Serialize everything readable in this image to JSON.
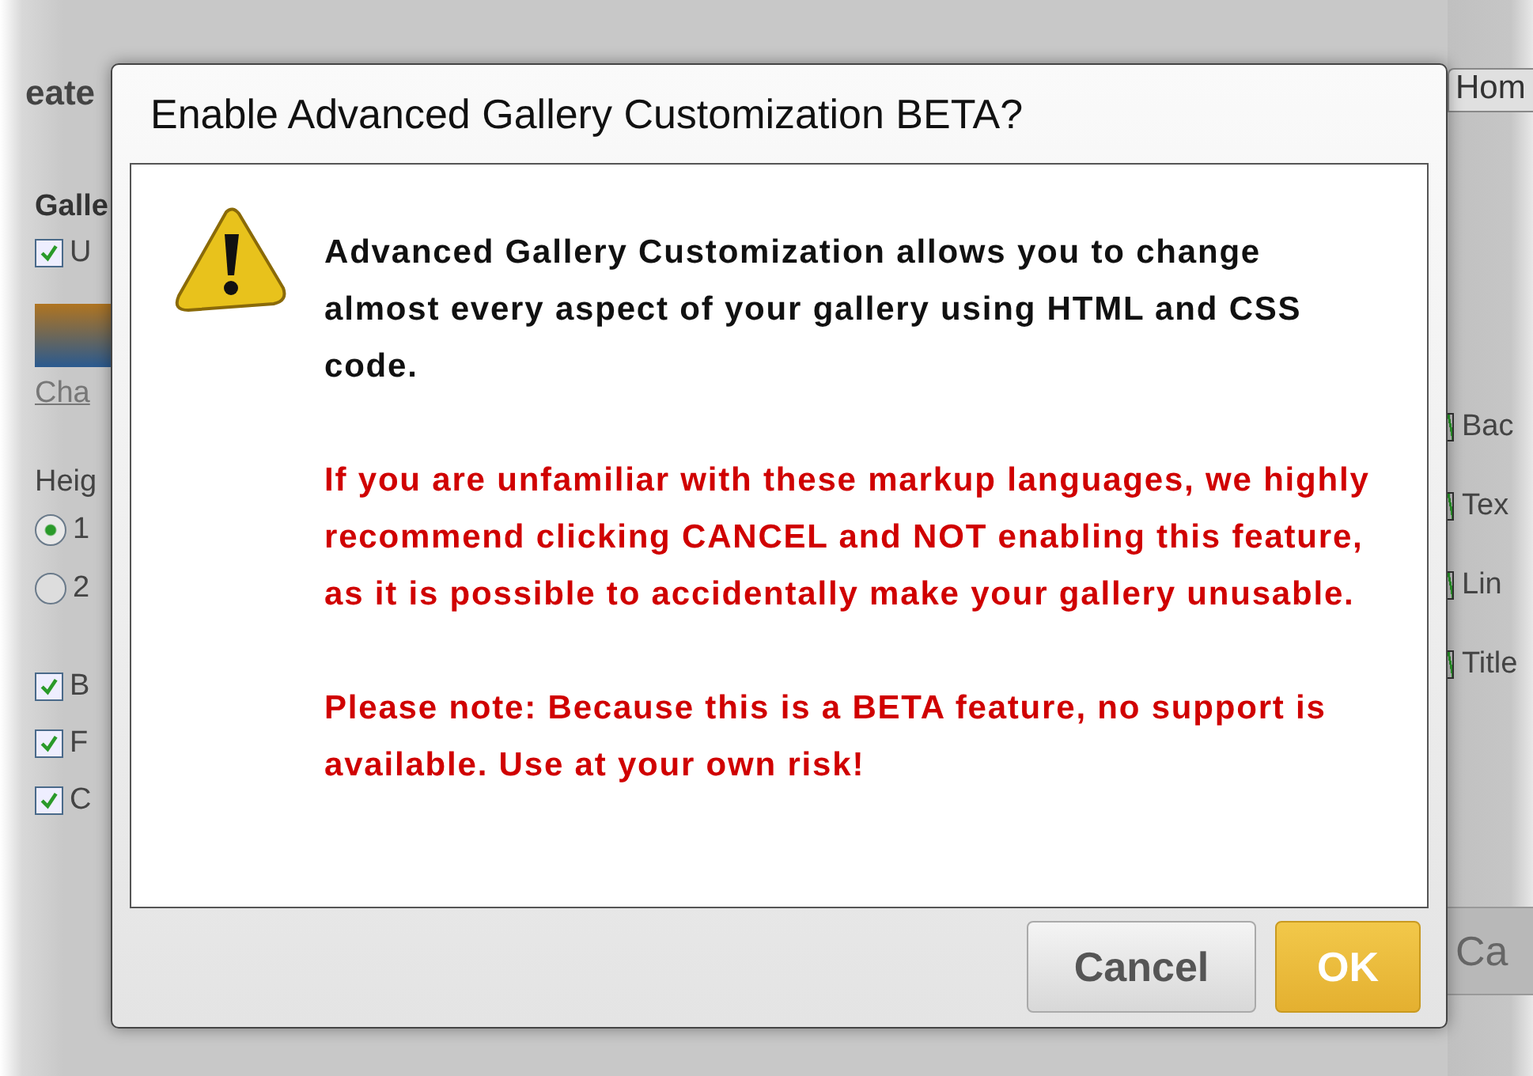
{
  "background": {
    "title_fragment": "eate",
    "section_heading": "Galle",
    "top_option": {
      "label": "U",
      "checked": true
    },
    "link": "Cha",
    "height_label": "Heig",
    "height_options": [
      {
        "label": "1",
        "selected": true
      },
      {
        "label": "2",
        "selected": false
      }
    ],
    "options": [
      {
        "label": "B",
        "checked": true
      },
      {
        "label": "F",
        "checked": true
      },
      {
        "label": "C",
        "checked": true
      }
    ],
    "tab": "Hom",
    "color_options": [
      {
        "label": "Bac",
        "checked": true
      },
      {
        "label": "Tex",
        "checked": true
      },
      {
        "label": "Lin",
        "checked": true
      },
      {
        "label": "Title",
        "checked": true
      }
    ],
    "button": "Ca"
  },
  "dialog": {
    "title": "Enable Advanced Gallery Customization BETA?",
    "message": "Advanced Gallery Customization allows you to change almost every aspect of your gallery using HTML and CSS code.",
    "warnings": [
      "If you are unfamiliar with these markup languages, we highly recommend clicking CANCEL and NOT enabling this feature, as it is possible to accidentally make your gallery unusable.",
      "Please note: Because this is a BETA feature, no support is available. Use at your own risk!"
    ],
    "buttons": [
      {
        "label": "Cancel",
        "kind": "secondary"
      },
      {
        "label": "OK",
        "kind": "primary"
      }
    ]
  }
}
